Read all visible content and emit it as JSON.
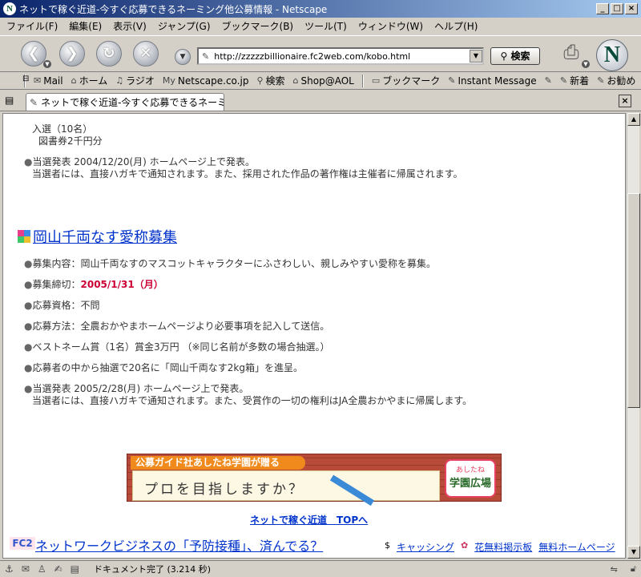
{
  "window": {
    "title": "ネットで稼ぐ近道-今すぐ応募できるネーミング他公募情報 - Netscape",
    "app_icon": "N",
    "minimize": "_",
    "maximize": "□",
    "close": "×"
  },
  "menu": [
    "ファイル(F)",
    "編集(E)",
    "表示(V)",
    "ジャンプ(G)",
    "ブックマーク(B)",
    "ツール(T)",
    "ウィンドウ(W)",
    "ヘルプ(H)"
  ],
  "nav": {
    "url": "http://zzzzzbillionaire.fc2web.com/kobo.html",
    "search_label": "検索",
    "logo": "N"
  },
  "personal": [
    {
      "icon": "mail-icon",
      "glyph": "✉",
      "label": "Mail"
    },
    {
      "icon": "home-icon",
      "glyph": "⌂",
      "label": "ホーム"
    },
    {
      "icon": "radio-icon",
      "glyph": "♫",
      "label": "ラジオ"
    },
    {
      "icon": "my-icon",
      "glyph": "My",
      "label": "Netscape.co.jp"
    },
    {
      "icon": "search-icon",
      "glyph": "⚲",
      "label": "検索"
    },
    {
      "icon": "aol-icon",
      "glyph": "⌂",
      "label": "Shop@AOL"
    },
    {
      "icon": "folder-icon",
      "glyph": "▭",
      "label": "ブックマーク"
    },
    {
      "icon": "bookmark-icon",
      "glyph": "✎",
      "label": "Instant Message"
    },
    {
      "icon": "bookmark-icon",
      "glyph": "✎",
      "label": ""
    },
    {
      "icon": "bookmark-icon",
      "glyph": "✎",
      "label": "新着"
    },
    {
      "icon": "bookmark-icon",
      "glyph": "✎",
      "label": "お勧め"
    }
  ],
  "tab": {
    "label": "ネットで稼ぐ近道-今すぐ応募できるネーミング…",
    "close": "×"
  },
  "content": {
    "prize_line1": "入選（10名）",
    "prize_line2": "図書券2千円分",
    "announce1_a": "当選発表 2004/12/20(月) ホームページ上で発表。",
    "announce1_b": "当選者には、直接ハガキで通知されます。また、採用された作品の著作権は主催者に帰属されます。",
    "heading": "岡山千両なす愛称募集",
    "item_content": "募集内容：岡山千両なすのマスコットキャラクターにふさわしい、親しみやすい愛称を募集。",
    "item_deadline_label": "募集締切：",
    "item_deadline_value": "2005/1/31（月）",
    "item_qual": "応募資格：不問",
    "item_method": "応募方法：全農おかやまホームページより必要事項を記入して送信。",
    "item_best": "ベストネーム賞（1名）賞金3万円 （※同じ名前が多数の場合抽選。）",
    "item_lottery": "応募者の中から抽選で20名に「岡山千両なす2kg箱」を進呈。",
    "announce2_a": "当選発表 2005/2/28(月) ホームページ上で発表。",
    "announce2_b": "当選者には、直接ハガキで通知されます。また、受賞作の一切の権利はJA全農おかやまに帰属します。",
    "banner_tag": "公募ガイド社あしたね学園が贈る",
    "banner_text": "プロを目指しますか？",
    "banner_logo1": "あしたね",
    "banner_logo2": "学園広場",
    "top_link": "ネットで稼ぐ近道　TOPへ",
    "fc2_badge": "FC2",
    "fc2_link": "ネットワークビジネスの「予防接種」、済んでる？",
    "footer_cashing": "キャッシング",
    "footer_board": "花無料掲示板",
    "footer_homepage": "無料ホームページ"
  },
  "status": {
    "text": "ドキュメント完了 (3.214 秒)"
  },
  "colors": {
    "accent_link": "#0033cc",
    "deadline": "#cc0033",
    "title_bar": "#0a246a"
  }
}
